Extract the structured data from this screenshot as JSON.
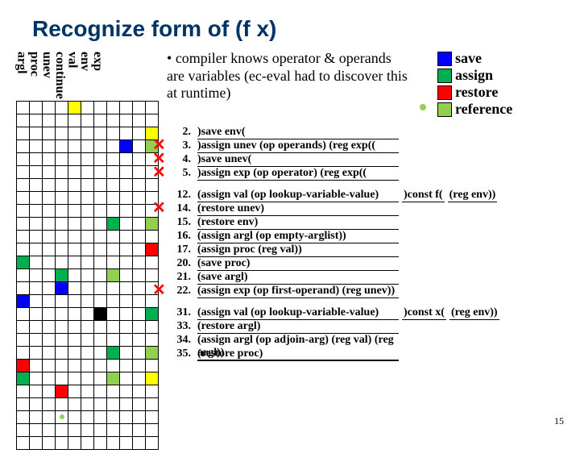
{
  "title": "Recognize form of (f x)",
  "registers": [
    "exp",
    "env",
    "val",
    "continue",
    "unev",
    "proc",
    "argl"
  ],
  "bullet": "compiler knows operator & operands are variables (ec-eval had to discover this at runtime)",
  "legend": {
    "save": {
      "label": "save",
      "color": "#0000ff"
    },
    "assign": {
      "label": "assign",
      "color": "#00b050"
    },
    "restore": {
      "label": "restore",
      "color": "#ff0000"
    },
    "reference": {
      "label": "reference",
      "color": "#92d050"
    }
  },
  "blocks": [
    {
      "rows": [
        {
          "num": "2.",
          "text": ")save env(",
          "strike": false
        },
        {
          "num": "3.",
          "text": ")assign unev (op operands) (reg exp((",
          "strike": true
        },
        {
          "num": "4.",
          "text": ")save unev(",
          "strike": true
        },
        {
          "num": "5.",
          "text": ")assign exp (op operator) (reg exp((",
          "strike": true
        }
      ]
    },
    {
      "rows": [
        {
          "num": "12.",
          "text": "(assign val (op lookup-variable-value)",
          "strike": false,
          "annot1": ")const f(",
          "annot2": "(reg env))"
        },
        {
          "num": "14.",
          "text": "(restore unev)",
          "strike": true
        },
        {
          "num": "15.",
          "text": "(restore env)",
          "strike": false
        },
        {
          "num": "16.",
          "text": "(assign argl (op empty-arglist))",
          "strike": false
        },
        {
          "num": "17.",
          "text": "(assign proc (reg val))",
          "strike": false
        },
        {
          "num": "20.",
          "text": "(save proc)",
          "strike": false
        },
        {
          "num": "21.",
          "text": "(save argl)",
          "strike": false
        },
        {
          "num": "22.",
          "text": "(assign exp (op first-operand) (reg unev))",
          "strike": true
        }
      ]
    },
    {
      "rows": [
        {
          "num": "31.",
          "text": "(assign val (op lookup-variable-value)",
          "strike": false,
          "annot1": ")const x(",
          "annot2": "(reg env))"
        },
        {
          "num": "33.",
          "text": "(restore argl)",
          "strike": false
        },
        {
          "num": "34.",
          "text": "(assign argl (op adjoin-arg) (reg val) (reg argl))",
          "strike": false
        },
        {
          "num": "35.",
          "text": "(restore proc)",
          "strike": false
        }
      ]
    }
  ],
  "grid": {
    "cols": 11,
    "rows": 27,
    "cells": [
      {
        "r": 0,
        "c": 4,
        "color": "#ffff00"
      },
      {
        "r": 2,
        "c": 10,
        "color": "#ffff00"
      },
      {
        "r": 3,
        "c": 8,
        "color": "#0000ff"
      },
      {
        "r": 3,
        "c": 10,
        "color": "#92d050"
      },
      {
        "r": 9,
        "c": 7,
        "color": "#00b050"
      },
      {
        "r": 9,
        "c": 10,
        "color": "#92d050"
      },
      {
        "r": 11,
        "c": 10,
        "color": "#ff0000"
      },
      {
        "r": 12,
        "c": 0,
        "color": "#00b050"
      },
      {
        "r": 13,
        "c": 3,
        "color": "#00b050"
      },
      {
        "r": 13,
        "c": 7,
        "color": "#92d050"
      },
      {
        "r": 14,
        "c": 3,
        "color": "#0000ff"
      },
      {
        "r": 15,
        "c": 0,
        "color": "#0000ff"
      },
      {
        "r": 16,
        "c": 6,
        "color": "#000000"
      },
      {
        "r": 16,
        "c": 10,
        "color": "#00b050"
      },
      {
        "r": 19,
        "c": 7,
        "color": "#00b050"
      },
      {
        "r": 19,
        "c": 10,
        "color": "#92d050"
      },
      {
        "r": 20,
        "c": 0,
        "color": "#ff0000"
      },
      {
        "r": 21,
        "c": 0,
        "color": "#00b050"
      },
      {
        "r": 21,
        "c": 7,
        "color": "#92d050"
      },
      {
        "r": 21,
        "c": 10,
        "color": "#ffff00"
      },
      {
        "r": 22,
        "c": 3,
        "color": "#ff0000"
      },
      {
        "r": 24,
        "c": 3,
        "dot": "#92d050"
      }
    ]
  },
  "page_number": "15"
}
